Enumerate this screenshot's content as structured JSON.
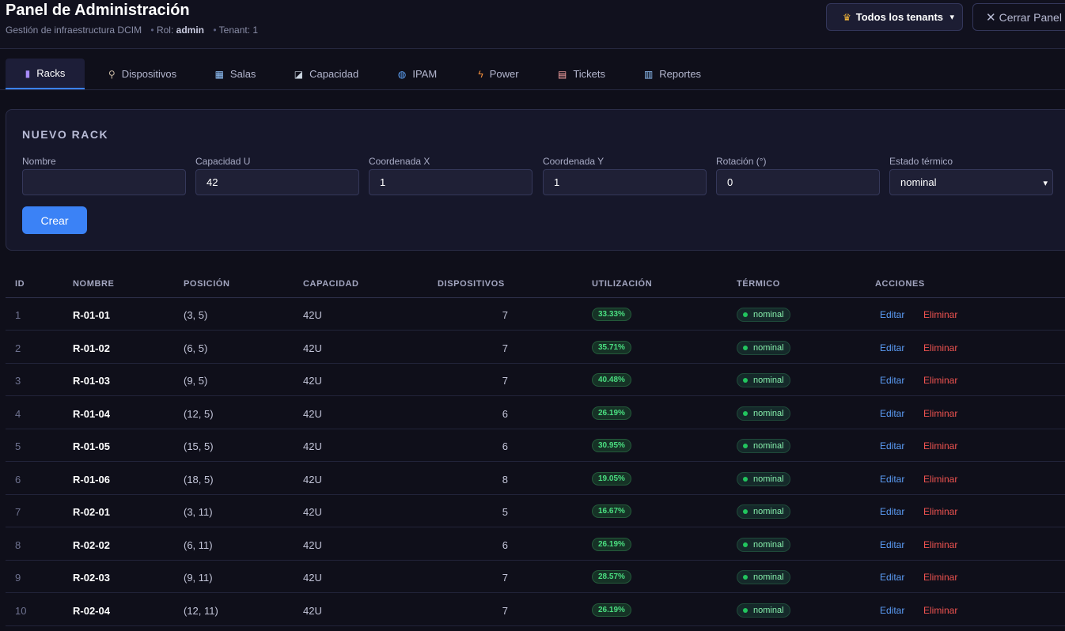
{
  "header": {
    "title": "Panel de Administración",
    "subtitle_desc": "Gestión de infraestructura DCIM",
    "role_label": "Rol:",
    "role_value": "admin",
    "tenant_label": "Tenant: 1",
    "tenant_select": "Todos los tenants",
    "close_label": "Cerrar Panel"
  },
  "tabs": [
    {
      "label": "Racks",
      "icon": "rack-icon",
      "glyph": "▮"
    },
    {
      "label": "Dispositivos",
      "icon": "plug-icon",
      "glyph": "⚲"
    },
    {
      "label": "Salas",
      "icon": "building-icon",
      "glyph": "▦"
    },
    {
      "label": "Capacidad",
      "icon": "chart-icon",
      "glyph": "◪"
    },
    {
      "label": "IPAM",
      "icon": "globe-icon",
      "glyph": "◍"
    },
    {
      "label": "Power",
      "icon": "bolt-icon",
      "glyph": "ϟ"
    },
    {
      "label": "Tickets",
      "icon": "ticket-icon",
      "glyph": "▤"
    },
    {
      "label": "Reportes",
      "icon": "report-icon",
      "glyph": "▥"
    }
  ],
  "form": {
    "title": "NUEVO RACK",
    "fields": [
      {
        "label": "Nombre",
        "value": ""
      },
      {
        "label": "Capacidad U",
        "value": "42"
      },
      {
        "label": "Coordenada X",
        "value": "1"
      },
      {
        "label": "Coordenada Y",
        "value": "1"
      },
      {
        "label": "Rotación (°)",
        "value": "0"
      },
      {
        "label": "Estado térmico",
        "value": "nominal"
      }
    ],
    "create_label": "Crear"
  },
  "table": {
    "headers": [
      "ID",
      "NOMBRE",
      "POSICIÓN",
      "CAPACIDAD",
      "DISPOSITIVOS",
      "UTILIZACIÓN",
      "TÉRMICO",
      "ACCIONES"
    ],
    "edit_label": "Editar",
    "delete_label": "Eliminar",
    "rows": [
      {
        "id": "1",
        "name": "R-01-01",
        "pos": "(3, 5)",
        "cap": "42U",
        "dev": "7",
        "util": "33.33%",
        "thermal": "nominal"
      },
      {
        "id": "2",
        "name": "R-01-02",
        "pos": "(6, 5)",
        "cap": "42U",
        "dev": "7",
        "util": "35.71%",
        "thermal": "nominal"
      },
      {
        "id": "3",
        "name": "R-01-03",
        "pos": "(9, 5)",
        "cap": "42U",
        "dev": "7",
        "util": "40.48%",
        "thermal": "nominal"
      },
      {
        "id": "4",
        "name": "R-01-04",
        "pos": "(12, 5)",
        "cap": "42U",
        "dev": "6",
        "util": "26.19%",
        "thermal": "nominal"
      },
      {
        "id": "5",
        "name": "R-01-05",
        "pos": "(15, 5)",
        "cap": "42U",
        "dev": "6",
        "util": "30.95%",
        "thermal": "nominal"
      },
      {
        "id": "6",
        "name": "R-01-06",
        "pos": "(18, 5)",
        "cap": "42U",
        "dev": "8",
        "util": "19.05%",
        "thermal": "nominal"
      },
      {
        "id": "7",
        "name": "R-02-01",
        "pos": "(3, 11)",
        "cap": "42U",
        "dev": "5",
        "util": "16.67%",
        "thermal": "nominal"
      },
      {
        "id": "8",
        "name": "R-02-02",
        "pos": "(6, 11)",
        "cap": "42U",
        "dev": "6",
        "util": "26.19%",
        "thermal": "nominal"
      },
      {
        "id": "9",
        "name": "R-02-03",
        "pos": "(9, 11)",
        "cap": "42U",
        "dev": "7",
        "util": "28.57%",
        "thermal": "nominal"
      },
      {
        "id": "10",
        "name": "R-02-04",
        "pos": "(12, 11)",
        "cap": "42U",
        "dev": "7",
        "util": "26.19%",
        "thermal": "nominal"
      }
    ]
  },
  "colors": {
    "accent": "#3b82f6",
    "success": "#4ade80",
    "danger": "#ef5350",
    "background": "#0f0f1a"
  }
}
